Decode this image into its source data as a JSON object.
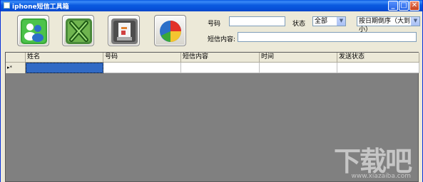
{
  "window": {
    "title": "iphone短信工具箱",
    "min_label": "_",
    "max_label": "□",
    "close_label": "✕"
  },
  "toolbar": {
    "buttons": [
      {
        "name": "contacts-button",
        "icon": "contacts-icon"
      },
      {
        "name": "excel-export-button",
        "icon": "excel-icon"
      },
      {
        "name": "print-button",
        "icon": "print-icon"
      },
      {
        "name": "chart-button",
        "icon": "pie-chart-icon"
      }
    ]
  },
  "filters": {
    "number_label": "号码",
    "number_value": "",
    "status_label": "状态",
    "status_selected": "全部",
    "sort_selected": "按日期倒序（大到小）",
    "content_label": "短信内容:",
    "content_value": ""
  },
  "grid": {
    "columns": [
      "姓名",
      "号码",
      "短信内容",
      "时间",
      "发送状态"
    ],
    "new_row_marker": "▸*"
  },
  "watermark": {
    "text": "下载吧",
    "url": "www.xiazaiba.com"
  },
  "colors": {
    "titlebar": "#0a5ae0",
    "grid_background": "#808080",
    "selected_cell": "#316ac5"
  }
}
